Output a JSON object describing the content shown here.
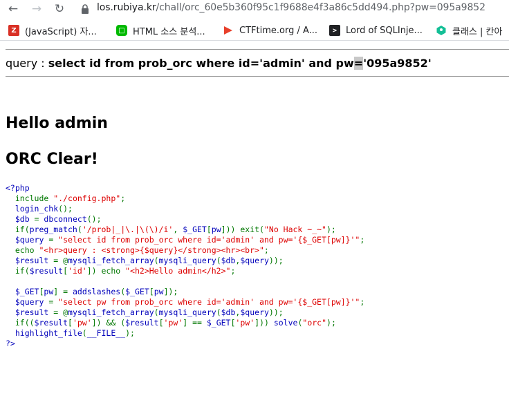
{
  "browser": {
    "url_host": "los.rubiya.kr",
    "url_path": "/chall/orc_60e5b360f95c1f9688e4f3a86c5dd494.php?pw=095a9852",
    "bookmarks": [
      {
        "label": "(JavaScript) 자...",
        "icon": "z-logo-icon",
        "color": "#d93025"
      },
      {
        "label": "HTML 소스 분석...",
        "icon": "line-chat-icon",
        "color": "#00b900"
      },
      {
        "label": "CTFtime.org / A...",
        "icon": "ctftime-flag-icon",
        "color": "#e8402b"
      },
      {
        "label": "Lord of SQLInje...",
        "icon": "terminal-icon",
        "color": "#202124"
      },
      {
        "label": "클래스 | 칸아",
        "icon": "khan-academy-icon",
        "color": "#14bf96"
      }
    ]
  },
  "page": {
    "query_prefix": "query : ",
    "query_sql_a": "select id from prob_orc where id='admin' and pw",
    "query_sql_sel": "=",
    "query_sql_b": "'095a9852'",
    "hello": "Hello admin",
    "clear": "ORC Clear!"
  },
  "source": {
    "open_tag": "<?php",
    "l1_kw": "  include ",
    "l1_str": "\"./config.php\"",
    "l1_end": ";",
    "l2_def": "  login_chk",
    "l2_kw": "();",
    "l3_def": "  $db ",
    "l3_kw": "= ",
    "l3_def2": "dbconnect",
    "l3_kw2": "();",
    "l4_kw": "  if(",
    "l4_def": "preg_match",
    "l4_kw2": "(",
    "l4_str": "'/prob|_|\\.|\\(\\)/i'",
    "l4_kw3": ", ",
    "l4_def2": "$_GET",
    "l4_kw4": "[",
    "l4_def3": "pw",
    "l4_kw5": "])) exit(",
    "l4_str2": "\"No Hack ~_~\"",
    "l4_kw6": ");",
    "l5_def": "  $query ",
    "l5_kw": "= ",
    "l5_str": "\"select id from prob_orc where id='admin' and pw='{$_GET[pw]}'\"",
    "l5_kw2": ";",
    "l6_kw": "  echo ",
    "l6_str": "\"<hr>query : <strong>{$query}</strong><hr><br>\"",
    "l6_kw2": ";",
    "l7_def": "  $result ",
    "l7_kw": "= @",
    "l7_def2": "mysqli_fetch_array",
    "l7_kw2": "(",
    "l7_def3": "mysqli_query",
    "l7_kw3": "(",
    "l7_def4": "$db",
    "l7_kw4": ",",
    "l7_def5": "$query",
    "l7_kw5": "));",
    "l8_kw": "  if(",
    "l8_def": "$result",
    "l8_kw2": "[",
    "l8_str": "'id'",
    "l8_kw3": "]) echo ",
    "l8_str2": "\"<h2>Hello admin</h2>\"",
    "l8_kw4": ";",
    "l9_def": "  $_GET",
    "l9_kw": "[",
    "l9_def2": "pw",
    "l9_kw2": "] = ",
    "l9_def3": "addslashes",
    "l9_kw3": "(",
    "l9_def4": "$_GET",
    "l9_kw4": "[",
    "l9_def5": "pw",
    "l9_kw5": "]);",
    "l10_def": "  $query ",
    "l10_kw": "= ",
    "l10_str": "\"select pw from prob_orc where id='admin' and pw='{$_GET[pw]}'\"",
    "l10_kw2": ";",
    "l11_def": "  $result ",
    "l11_kw": "= @",
    "l11_def2": "mysqli_fetch_array",
    "l11_kw2": "(",
    "l11_def3": "mysqli_query",
    "l11_kw3": "(",
    "l11_def4": "$db",
    "l11_kw4": ",",
    "l11_def5": "$query",
    "l11_kw5": "));",
    "l12_kw": "  if((",
    "l12_def": "$result",
    "l12_kw2": "[",
    "l12_str": "'pw'",
    "l12_kw3": "]) && (",
    "l12_def2": "$result",
    "l12_kw4": "[",
    "l12_str2": "'pw'",
    "l12_kw5": "] == ",
    "l12_def3": "$_GET",
    "l12_kw6": "[",
    "l12_str3": "'pw'",
    "l12_kw7": "])) ",
    "l12_def4": "solve",
    "l12_kw8": "(",
    "l12_str4": "\"orc\"",
    "l12_kw9": ");",
    "l13_def": "  highlight_file",
    "l13_kw": "(",
    "l13_def2": "__FILE__",
    "l13_kw2": ");",
    "close_tag": "?>"
  }
}
